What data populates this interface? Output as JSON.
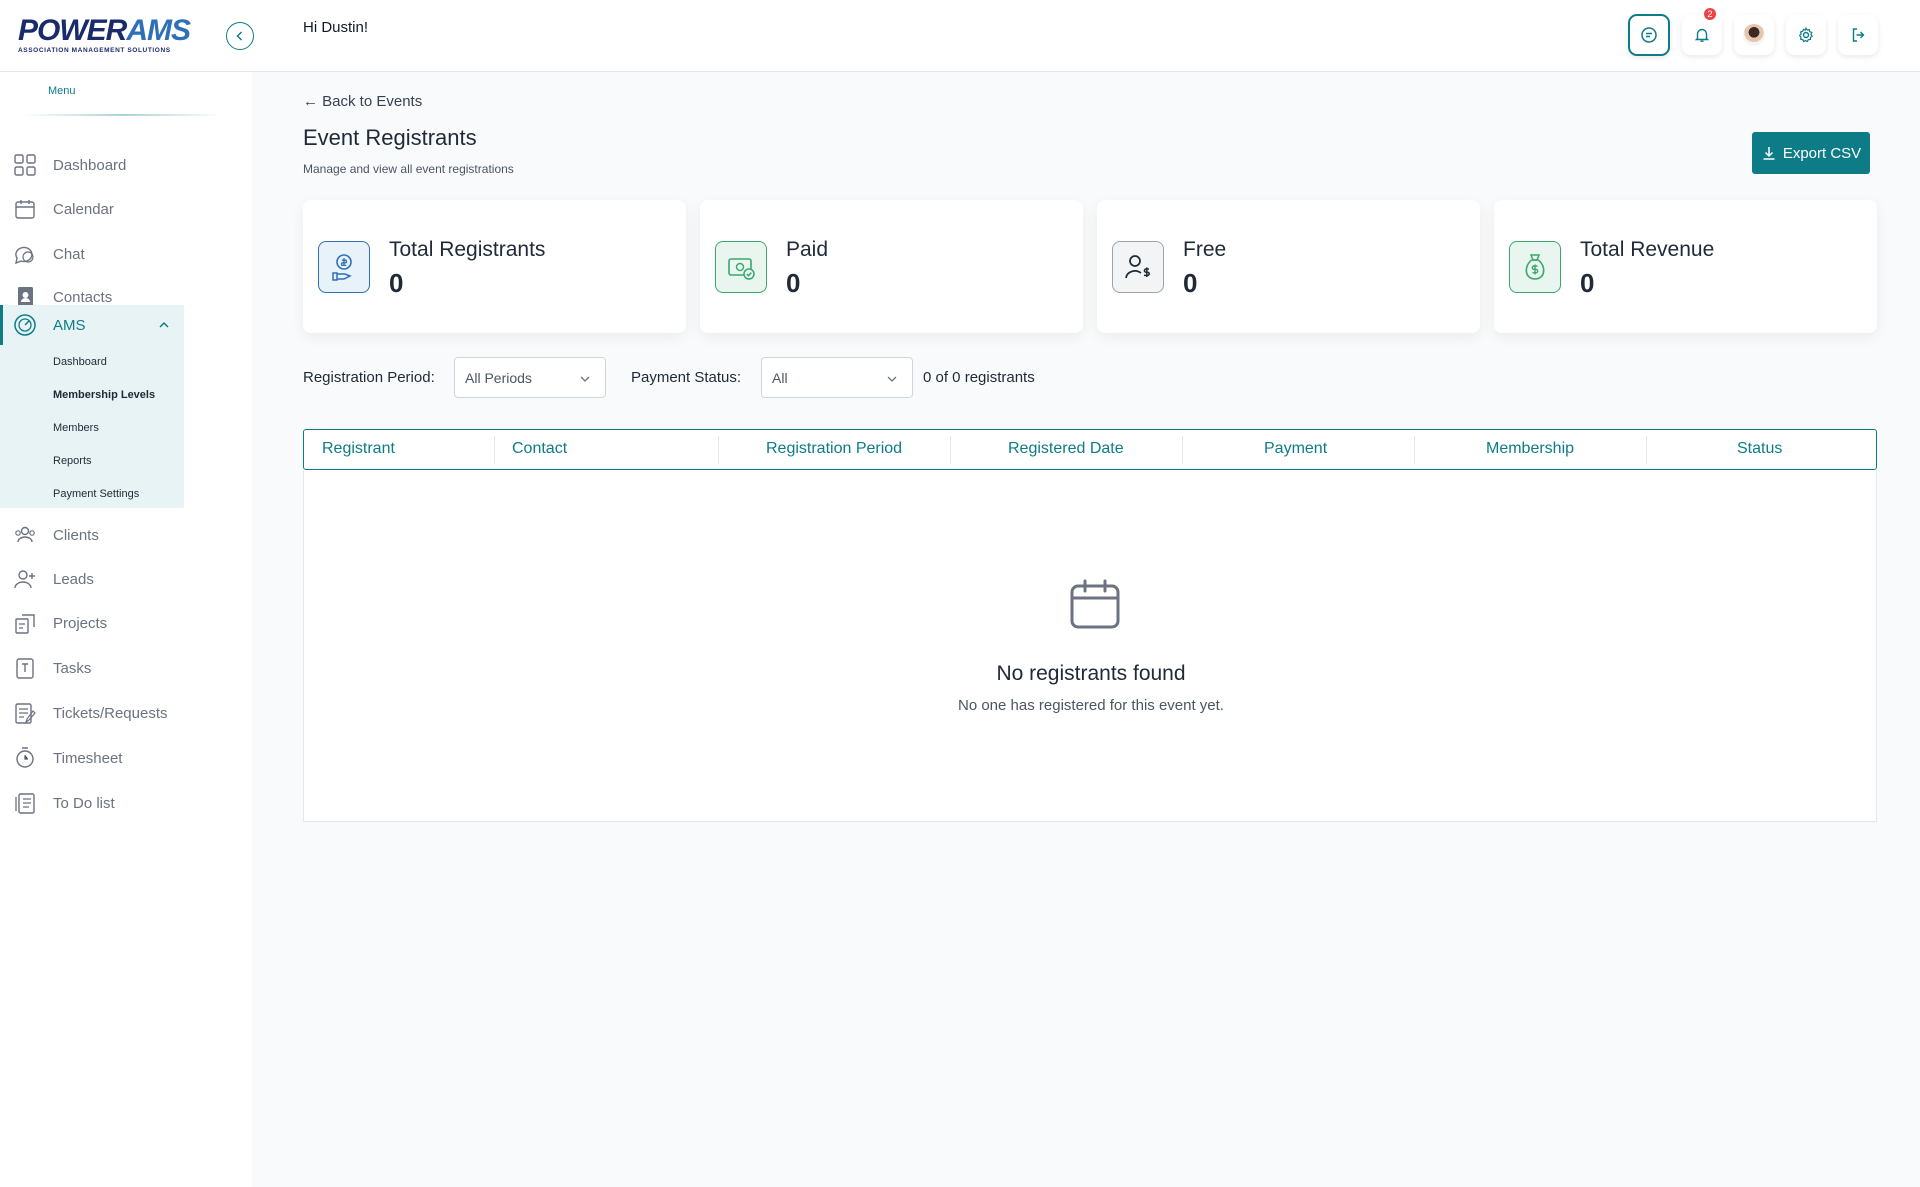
{
  "header": {
    "logo_main_a": "POWER",
    "logo_main_b": "AMS",
    "logo_sub": "ASSOCIATION MANAGEMENT SOLUTIONS",
    "greeting": "Hi Dustin!",
    "notification_count": "2"
  },
  "sidebar": {
    "menu_label": "Menu",
    "items": [
      {
        "label": "Dashboard",
        "icon": "dashboard-grid-icon"
      },
      {
        "label": "Calendar",
        "icon": "calendar-icon"
      },
      {
        "label": "Chat",
        "icon": "chat-icon"
      },
      {
        "label": "Contacts",
        "icon": "contacts-icon"
      },
      {
        "label": "Clients",
        "icon": "clients-icon"
      },
      {
        "label": "Leads",
        "icon": "leads-icon"
      },
      {
        "label": "Projects",
        "icon": "projects-icon"
      },
      {
        "label": "Tasks",
        "icon": "tasks-icon"
      },
      {
        "label": "Tickets/Requests",
        "icon": "tickets-icon"
      },
      {
        "label": "Timesheet",
        "icon": "timesheet-icon"
      },
      {
        "label": "To Do list",
        "icon": "todo-icon"
      }
    ],
    "ams": {
      "label": "AMS",
      "sub_items": [
        "Dashboard",
        "Membership Levels",
        "Members",
        "Reports",
        "Payment Settings"
      ]
    }
  },
  "page": {
    "back_link": "← Back to Events",
    "title": "Event Registrants",
    "subtitle": "Manage and view all event registrations",
    "export_label": "Export CSV"
  },
  "stats": [
    {
      "label": "Total Registrants",
      "value": "0"
    },
    {
      "label": "Paid",
      "value": "0"
    },
    {
      "label": "Free",
      "value": "0"
    },
    {
      "label": "Total Revenue",
      "value": "0"
    }
  ],
  "filters": {
    "period_label": "Registration Period:",
    "period_value": "All Periods",
    "payment_label": "Payment Status:",
    "payment_value": "All",
    "count_text": "0 of 0 registrants"
  },
  "table": {
    "columns": [
      "Registrant",
      "Contact",
      "Registration Period",
      "Registered Date",
      "Payment",
      "Membership",
      "Status"
    ],
    "empty_title": "No registrants found",
    "empty_subtitle": "No one has registered for this event yet."
  },
  "colors": {
    "accent": "#0e7c86",
    "brand_dark": "#1a2b6b",
    "brand_light": "#2f6fb7",
    "badge": "#ef4444"
  }
}
